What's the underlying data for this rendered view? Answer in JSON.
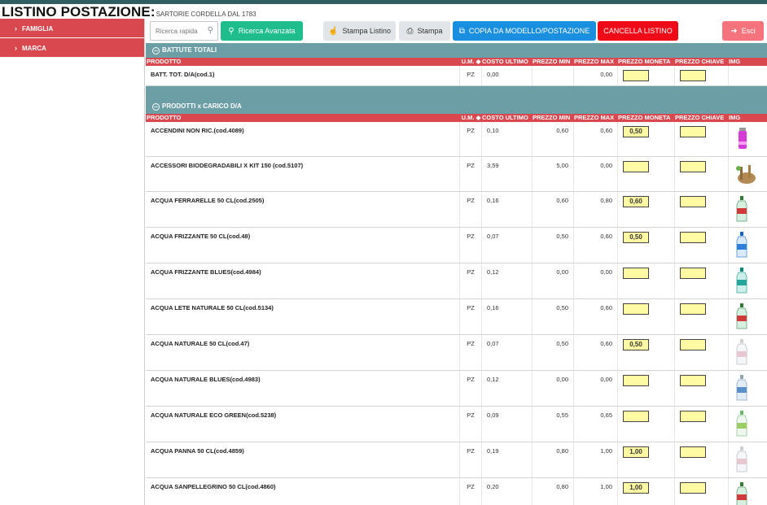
{
  "header": {
    "title": "LISTINO POSTAZIONE:",
    "subtitle": "SARTORIE CORDELLA DAL 1783"
  },
  "sidebar": {
    "items": [
      {
        "label": "FAMIGLIA",
        "icon": "chevron-right-icon"
      },
      {
        "label": "MARCA",
        "icon": "chevron-right-icon"
      }
    ]
  },
  "toolbar": {
    "search_placeholder": "Ricerca rapida",
    "advanced_search_label": "Ricerca Avanzata",
    "print_list_label": "Stampa Listino",
    "print_label": "Stampa",
    "copy_label": "COPIA DA MODELLO/POSTAZIONE",
    "delete_label": "CANCELLA LISTINO",
    "exit_label": "Esci",
    "colors": {
      "green": "#1fbc8c",
      "blue": "#1a8fe0",
      "red": "#ee0a16",
      "pink": "#f4737c",
      "section": "#6c9ea6",
      "header": "#d9474f"
    }
  },
  "columns": {
    "product": "PRODOTTO",
    "um": "U.M.",
    "cost": "COSTO ULTIMO",
    "min": "PREZZO MIN",
    "max": "PREZZO MAX",
    "coin": "PREZZO MONETA",
    "key": "PREZZO CHIAVE",
    "img": "IMG"
  },
  "sections": [
    {
      "title": "BATTUTE TOTALI",
      "rows": [
        {
          "name": "BATT. TOT. D/A(cod.1)",
          "um": "PZ",
          "cost": "0,00",
          "min": "",
          "max": "0,00",
          "coin": "",
          "key": "",
          "img": ""
        }
      ]
    },
    {
      "title": "PRODOTTI x CARICO D/A",
      "rows": [
        {
          "name": "ACCENDINI NON RIC.(cod.4089)",
          "um": "PZ",
          "cost": "0,10",
          "min": "0,60",
          "max": "0,60",
          "coin": "0,50",
          "key": "",
          "img": "lighter"
        },
        {
          "name": "ACCESSORI BIODEGRADABILI X KIT 150 (cod.5107)",
          "um": "PZ",
          "cost": "3,59",
          "min": "5,00",
          "max": "0,00",
          "coin": "",
          "key": "",
          "img": "eco-kit"
        },
        {
          "name": "ACQUA FERRARELLE 50 CL(cod.2505)",
          "um": "PZ",
          "cost": "0,16",
          "min": "0,60",
          "max": "0,80",
          "coin": "0,60",
          "key": "",
          "img": "bottle-green-red"
        },
        {
          "name": "ACQUA FRIZZANTE 50 CL(cod.48)",
          "um": "PZ",
          "cost": "0,07",
          "min": "0,50",
          "max": "0,60",
          "coin": "0,50",
          "key": "",
          "img": "bottle-blue"
        },
        {
          "name": "ACQUA FRIZZANTE BLUES(cod.4984)",
          "um": "PZ",
          "cost": "0,12",
          "min": "0,00",
          "max": "0,00",
          "coin": "",
          "key": "",
          "img": "bottle-teal"
        },
        {
          "name": "ACQUA LETE NATURALE 50 CL(cod.5134)",
          "um": "PZ",
          "cost": "0,16",
          "min": "0,50",
          "max": "0,60",
          "coin": "",
          "key": "",
          "img": "bottle-green-red"
        },
        {
          "name": "ACQUA NATURALE 50 CL(cod.47)",
          "um": "PZ",
          "cost": "0,07",
          "min": "0,50",
          "max": "0,60",
          "coin": "0,50",
          "key": "",
          "img": "bottle-clear"
        },
        {
          "name": "ACQUA NATURALE BLUES(cod.4983)",
          "um": "PZ",
          "cost": "0,12",
          "min": "0,00",
          "max": "0,00",
          "coin": "",
          "key": "",
          "img": "bottle-blue-light"
        },
        {
          "name": "ACQUA NATURALE ECO GREEN(cod.5238)",
          "um": "PZ",
          "cost": "0,09",
          "min": "0,55",
          "max": "0,65",
          "coin": "",
          "key": "",
          "img": "bottle-green-light"
        },
        {
          "name": "ACQUA PANNA 50 CL(cod.4859)",
          "um": "PZ",
          "cost": "0,19",
          "min": "0,80",
          "max": "1,00",
          "coin": "1,00",
          "key": "",
          "img": "bottle-clear"
        },
        {
          "name": "ACQUA SANPELLEGRINO 50 CL(cod.4860)",
          "um": "PZ",
          "cost": "0,20",
          "min": "0,80",
          "max": "1,00",
          "coin": "1,00",
          "key": "",
          "img": "bottle-green-red"
        }
      ]
    }
  ]
}
